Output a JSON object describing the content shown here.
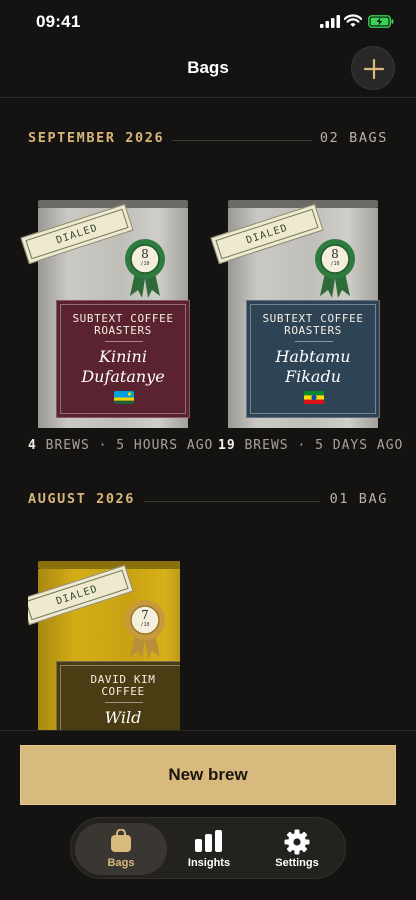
{
  "status_bar": {
    "time": "09:41"
  },
  "header": {
    "title": "Bags",
    "add_icon": "plus-icon"
  },
  "sections": [
    {
      "month": "SEPTEMBER 2026",
      "count": "02 BAGS",
      "bags": [
        {
          "roaster": "SUBTEXT COFFEE ROASTERS",
          "coffee": "Kinini Dufatanye",
          "stamp": "DIALED",
          "rating": "8",
          "rating_scale": "/10",
          "flag": "rwanda-flag-icon",
          "brews": "4",
          "brews_suffix": "BREWS · 5 HOURS AGO",
          "label_color": "#5b2230"
        },
        {
          "roaster": "SUBTEXT COFFEE ROASTERS",
          "coffee": "Habtamu Fikadu",
          "stamp": "DIALED",
          "rating": "8",
          "rating_scale": "/10",
          "flag": "ethiopia-flag-icon",
          "brews": "19",
          "brews_suffix": "BREWS · 5 DAYS AGO",
          "label_color": "#2e4354"
        }
      ]
    },
    {
      "month": "AUGUST 2026",
      "count": "01 BAG",
      "bags": [
        {
          "roaster": "DAVID KIM COFFEE",
          "coffee": "Wild",
          "stamp": "DIALED",
          "rating": "7",
          "rating_scale": "/10",
          "label_color": "#4a3d14"
        }
      ]
    }
  ],
  "actions": {
    "new_brew": "New brew"
  },
  "tabs": [
    {
      "label": "Bags",
      "icon": "bag-icon",
      "active": true
    },
    {
      "label": "Insights",
      "icon": "bar-chart-icon",
      "active": false
    },
    {
      "label": "Settings",
      "icon": "gear-icon",
      "active": false
    }
  ],
  "colors": {
    "accent": "#d8b97e",
    "section_month": "#d8b57a",
    "background": "#141312"
  }
}
